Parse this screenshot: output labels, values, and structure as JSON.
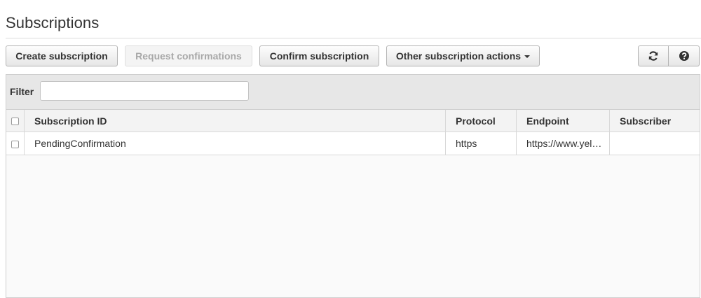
{
  "page": {
    "title": "Subscriptions"
  },
  "toolbar": {
    "create_label": "Create subscription",
    "request_label": "Request confirmations",
    "confirm_label": "Confirm subscription",
    "other_label": "Other subscription actions",
    "refresh_icon": "refresh-icon",
    "help_icon": "help-icon"
  },
  "filter": {
    "label": "Filter",
    "value": ""
  },
  "table": {
    "columns": [
      "Subscription ID",
      "Protocol",
      "Endpoint",
      "Subscriber"
    ],
    "rows": [
      {
        "subscription_id": "PendingConfirmation",
        "protocol": "https",
        "endpoint": "https://www.yel…",
        "subscriber": ""
      }
    ]
  }
}
